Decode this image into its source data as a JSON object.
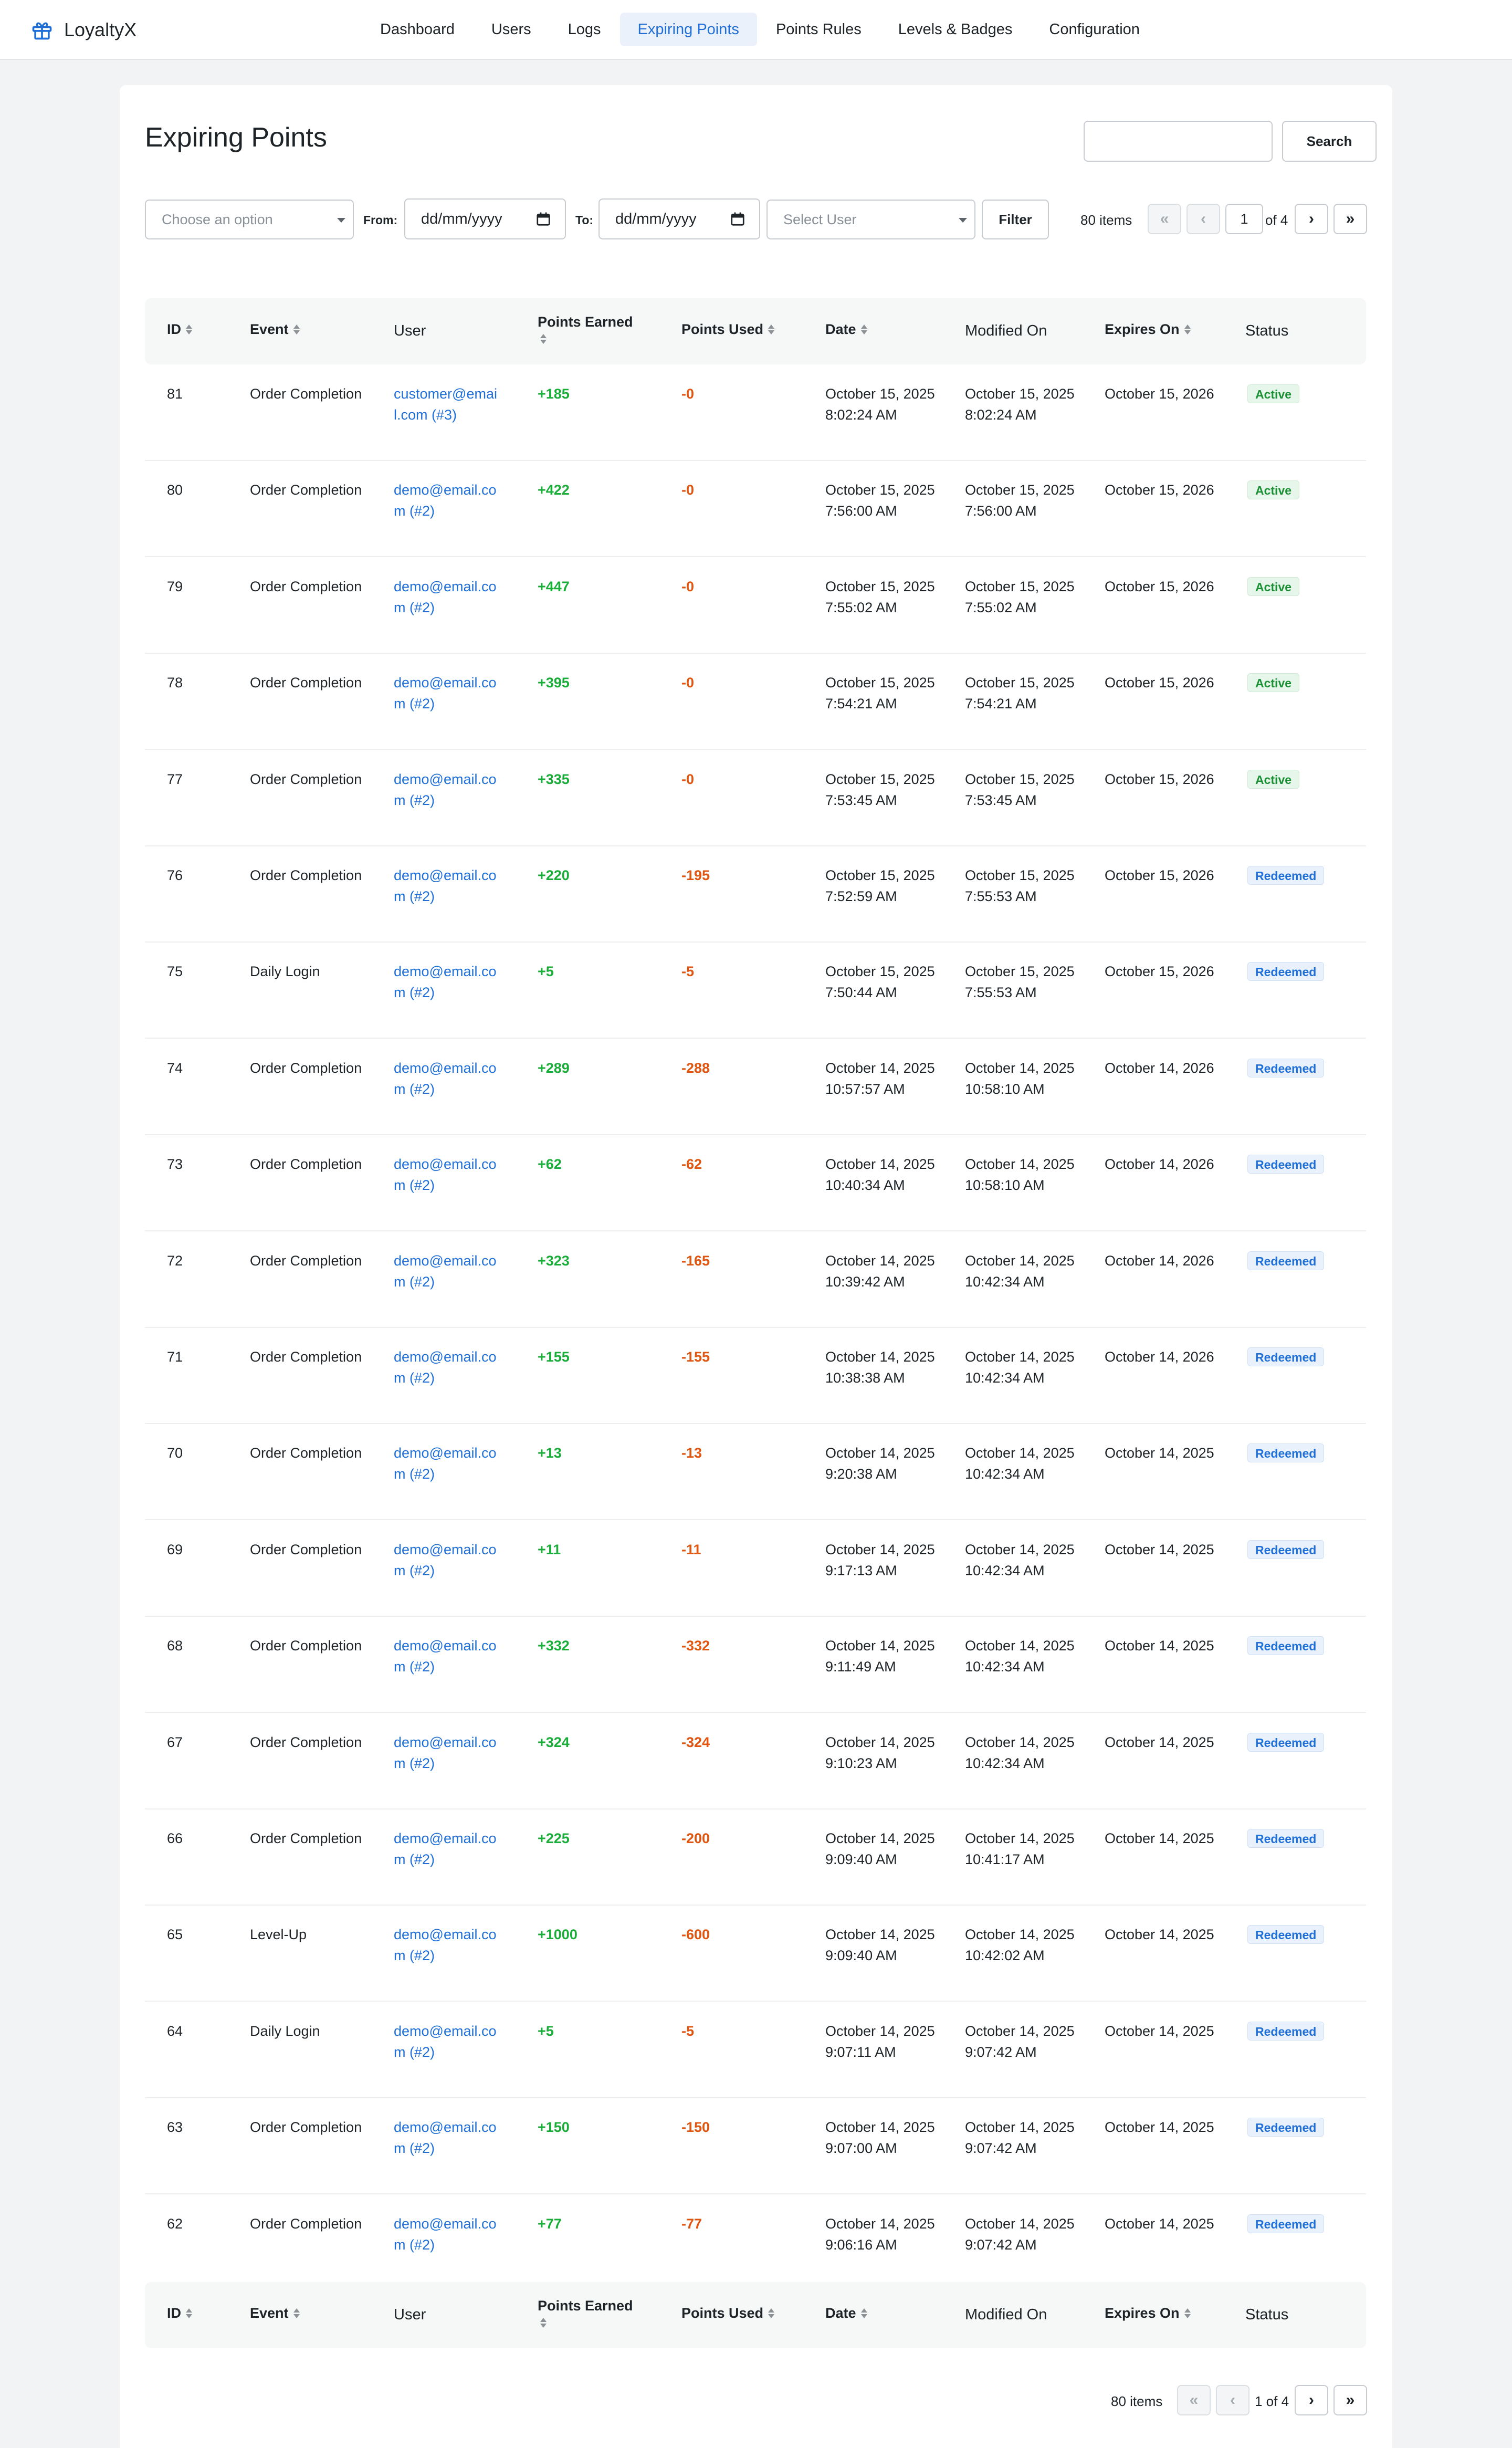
{
  "app": {
    "name": "LoyaltyX",
    "logo_icon": "gift-icon",
    "accent": "#1f6fd6"
  },
  "nav": [
    {
      "label": "Dashboard",
      "active": false
    },
    {
      "label": "Users",
      "active": false
    },
    {
      "label": "Logs",
      "active": false
    },
    {
      "label": "Expiring Points",
      "active": true
    },
    {
      "label": "Points Rules",
      "active": false
    },
    {
      "label": "Levels & Badges",
      "active": false
    },
    {
      "label": "Configuration",
      "active": false
    }
  ],
  "page": {
    "title": "Expiring Points"
  },
  "search": {
    "value": "",
    "button": "Search"
  },
  "filters": {
    "option_placeholder": "Choose an option",
    "from_label": "From:",
    "to_label": "To:",
    "date_placeholder": "dd/mm/yyyy",
    "user_placeholder": "Select User",
    "filter_button": "Filter"
  },
  "pagination": {
    "items": "80 items",
    "first": "«",
    "prev": "‹",
    "next": "›",
    "last": "»",
    "current": "1",
    "of_top": "of 4",
    "bottom_label": "1 of 4"
  },
  "columns": {
    "id": "ID",
    "event": "Event",
    "user": "User",
    "points_earned": "Points Earned",
    "points_used": "Points Used",
    "date": "Date",
    "modified_on": "Modified On",
    "expires_on": "Expires On",
    "status": "Status"
  },
  "colors": {
    "earned": "#1aad3a",
    "used": "#e0550f",
    "active": "#1a8f34",
    "redeemed": "#1f6fd6"
  },
  "rows": [
    {
      "id": "81",
      "event": "Order Completion",
      "user": "customer@email.com (#3)",
      "earned": "+185",
      "used": "-0",
      "date": "October 15, 2025 8:02:24 AM",
      "modified": "October 15, 2025 8:02:24 AM",
      "expires": "October 15, 2026",
      "status": "Active"
    },
    {
      "id": "80",
      "event": "Order Completion",
      "user": "demo@email.com (#2)",
      "earned": "+422",
      "used": "-0",
      "date": "October 15, 2025 7:56:00 AM",
      "modified": "October 15, 2025 7:56:00 AM",
      "expires": "October 15, 2026",
      "status": "Active"
    },
    {
      "id": "79",
      "event": "Order Completion",
      "user": "demo@email.com (#2)",
      "earned": "+447",
      "used": "-0",
      "date": "October 15, 2025 7:55:02 AM",
      "modified": "October 15, 2025 7:55:02 AM",
      "expires": "October 15, 2026",
      "status": "Active"
    },
    {
      "id": "78",
      "event": "Order Completion",
      "user": "demo@email.com (#2)",
      "earned": "+395",
      "used": "-0",
      "date": "October 15, 2025 7:54:21 AM",
      "modified": "October 15, 2025 7:54:21 AM",
      "expires": "October 15, 2026",
      "status": "Active"
    },
    {
      "id": "77",
      "event": "Order Completion",
      "user": "demo@email.com (#2)",
      "earned": "+335",
      "used": "-0",
      "date": "October 15, 2025 7:53:45 AM",
      "modified": "October 15, 2025 7:53:45 AM",
      "expires": "October 15, 2026",
      "status": "Active"
    },
    {
      "id": "76",
      "event": "Order Completion",
      "user": "demo@email.com (#2)",
      "earned": "+220",
      "used": "-195",
      "date": "October 15, 2025 7:52:59 AM",
      "modified": "October 15, 2025 7:55:53 AM",
      "expires": "October 15, 2026",
      "status": "Redeemed"
    },
    {
      "id": "75",
      "event": "Daily Login",
      "user": "demo@email.com (#2)",
      "earned": "+5",
      "used": "-5",
      "date": "October 15, 2025 7:50:44 AM",
      "modified": "October 15, 2025 7:55:53 AM",
      "expires": "October 15, 2026",
      "status": "Redeemed"
    },
    {
      "id": "74",
      "event": "Order Completion",
      "user": "demo@email.com (#2)",
      "earned": "+289",
      "used": "-288",
      "date": "October 14, 2025 10:57:57 AM",
      "modified": "October 14, 2025 10:58:10 AM",
      "expires": "October 14, 2026",
      "status": "Redeemed"
    },
    {
      "id": "73",
      "event": "Order Completion",
      "user": "demo@email.com (#2)",
      "earned": "+62",
      "used": "-62",
      "date": "October 14, 2025 10:40:34 AM",
      "modified": "October 14, 2025 10:58:10 AM",
      "expires": "October 14, 2026",
      "status": "Redeemed"
    },
    {
      "id": "72",
      "event": "Order Completion",
      "user": "demo@email.com (#2)",
      "earned": "+323",
      "used": "-165",
      "date": "October 14, 2025 10:39:42 AM",
      "modified": "October 14, 2025 10:42:34 AM",
      "expires": "October 14, 2026",
      "status": "Redeemed"
    },
    {
      "id": "71",
      "event": "Order Completion",
      "user": "demo@email.com (#2)",
      "earned": "+155",
      "used": "-155",
      "date": "October 14, 2025 10:38:38 AM",
      "modified": "October 14, 2025 10:42:34 AM",
      "expires": "October 14, 2026",
      "status": "Redeemed"
    },
    {
      "id": "70",
      "event": "Order Completion",
      "user": "demo@email.com (#2)",
      "earned": "+13",
      "used": "-13",
      "date": "October 14, 2025 9:20:38 AM",
      "modified": "October 14, 2025 10:42:34 AM",
      "expires": "October 14, 2025",
      "status": "Redeemed"
    },
    {
      "id": "69",
      "event": "Order Completion",
      "user": "demo@email.com (#2)",
      "earned": "+11",
      "used": "-11",
      "date": "October 14, 2025 9:17:13 AM",
      "modified": "October 14, 2025 10:42:34 AM",
      "expires": "October 14, 2025",
      "status": "Redeemed"
    },
    {
      "id": "68",
      "event": "Order Completion",
      "user": "demo@email.com (#2)",
      "earned": "+332",
      "used": "-332",
      "date": "October 14, 2025 9:11:49 AM",
      "modified": "October 14, 2025 10:42:34 AM",
      "expires": "October 14, 2025",
      "status": "Redeemed"
    },
    {
      "id": "67",
      "event": "Order Completion",
      "user": "demo@email.com (#2)",
      "earned": "+324",
      "used": "-324",
      "date": "October 14, 2025 9:10:23 AM",
      "modified": "October 14, 2025 10:42:34 AM",
      "expires": "October 14, 2025",
      "status": "Redeemed"
    },
    {
      "id": "66",
      "event": "Order Completion",
      "user": "demo@email.com (#2)",
      "earned": "+225",
      "used": "-200",
      "date": "October 14, 2025 9:09:40 AM",
      "modified": "October 14, 2025 10:41:17 AM",
      "expires": "October 14, 2025",
      "status": "Redeemed"
    },
    {
      "id": "65",
      "event": "Level-Up",
      "user": "demo@email.com (#2)",
      "earned": "+1000",
      "used": "-600",
      "date": "October 14, 2025 9:09:40 AM",
      "modified": "October 14, 2025 10:42:02 AM",
      "expires": "October 14, 2025",
      "status": "Redeemed"
    },
    {
      "id": "64",
      "event": "Daily Login",
      "user": "demo@email.com (#2)",
      "earned": "+5",
      "used": "-5",
      "date": "October 14, 2025 9:07:11 AM",
      "modified": "October 14, 2025 9:07:42 AM",
      "expires": "October 14, 2025",
      "status": "Redeemed"
    },
    {
      "id": "63",
      "event": "Order Completion",
      "user": "demo@email.com (#2)",
      "earned": "+150",
      "used": "-150",
      "date": "October 14, 2025 9:07:00 AM",
      "modified": "October 14, 2025 9:07:42 AM",
      "expires": "October 14, 2025",
      "status": "Redeemed"
    },
    {
      "id": "62",
      "event": "Order Completion",
      "user": "demo@email.com (#2)",
      "earned": "+77",
      "used": "-77",
      "date": "October 14, 2025 9:06:16 AM",
      "modified": "October 14, 2025 9:07:42 AM",
      "expires": "October 14, 2025",
      "status": "Redeemed"
    }
  ]
}
